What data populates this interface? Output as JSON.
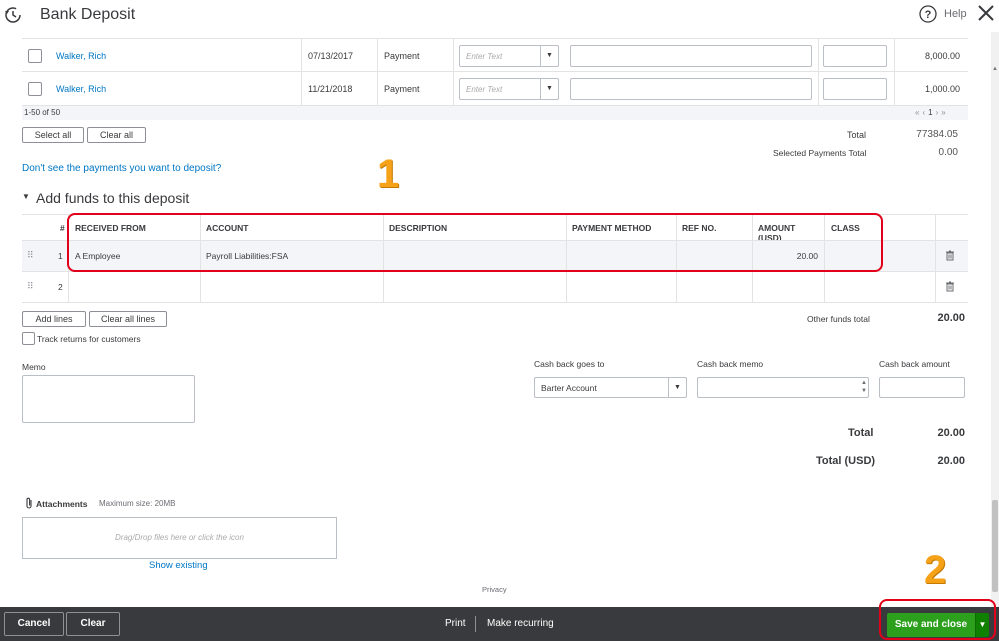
{
  "header": {
    "title": "Bank Deposit",
    "help": "Help"
  },
  "payments": {
    "rows": [
      {
        "name": "Walker, Rich",
        "date": "07/13/2017",
        "type": "Payment",
        "method_placeholder": "Enter Text",
        "amount": "8,000.00"
      },
      {
        "name": "Walker, Rich",
        "date": "11/21/2018",
        "type": "Payment",
        "method_placeholder": "Enter Text",
        "amount": "1,000.00"
      }
    ],
    "pager_range": "1-50 of 50",
    "pager_nav": [
      "«",
      "‹",
      "1",
      "›",
      "»"
    ],
    "select_all": "Select all",
    "clear_all": "Clear all",
    "total_label": "Total",
    "total_value": "77384.05",
    "selected_label": "Selected Payments Total",
    "selected_value": "0.00",
    "missing_link": "Don't see the payments you want to deposit?"
  },
  "funds": {
    "section_title": "Add funds to this deposit",
    "headers": {
      "num": "#",
      "received_from": "RECEIVED FROM",
      "account": "ACCOUNT",
      "description": "DESCRIPTION",
      "payment_method": "PAYMENT METHOD",
      "ref_no": "REF NO.",
      "amount": "AMOUNT (USD)",
      "class": "CLASS"
    },
    "rows": [
      {
        "num": "1",
        "received_from": "A Employee",
        "account": "Payroll Liabilities:FSA",
        "amount": "20.00"
      },
      {
        "num": "2",
        "received_from": "",
        "account": "",
        "amount": ""
      }
    ],
    "add_lines": "Add lines",
    "clear_all_lines": "Clear all lines",
    "track_returns": "Track returns for customers",
    "other_total_label": "Other funds total",
    "other_total_value": "20.00"
  },
  "memo": {
    "label": "Memo"
  },
  "cashback": {
    "goes_to_label": "Cash back goes to",
    "goes_to_value": "Barter Account",
    "memo_label": "Cash back memo",
    "amount_label": "Cash back amount"
  },
  "totals": {
    "total_label": "Total",
    "total_value": "20.00",
    "total_usd_label": "Total (USD)",
    "total_usd_value": "20.00"
  },
  "attachments": {
    "label": "Attachments",
    "max_size": "Maximum size: 20MB",
    "drop_text": "Drag/Drop files here or click the icon",
    "show_existing": "Show existing"
  },
  "privacy": "Privacy",
  "annotations": {
    "one": "1",
    "two": "2"
  },
  "footer": {
    "cancel": "Cancel",
    "clear": "Clear",
    "print": "Print",
    "make_recurring": "Make recurring",
    "save_close": "Save and close"
  },
  "colors": {
    "accent_green": "#2ca01c",
    "link_blue": "#0077c5",
    "annotation_red": "#e2001a",
    "annotation_orange": "#f6a219",
    "footer_bg": "#393a3d"
  }
}
